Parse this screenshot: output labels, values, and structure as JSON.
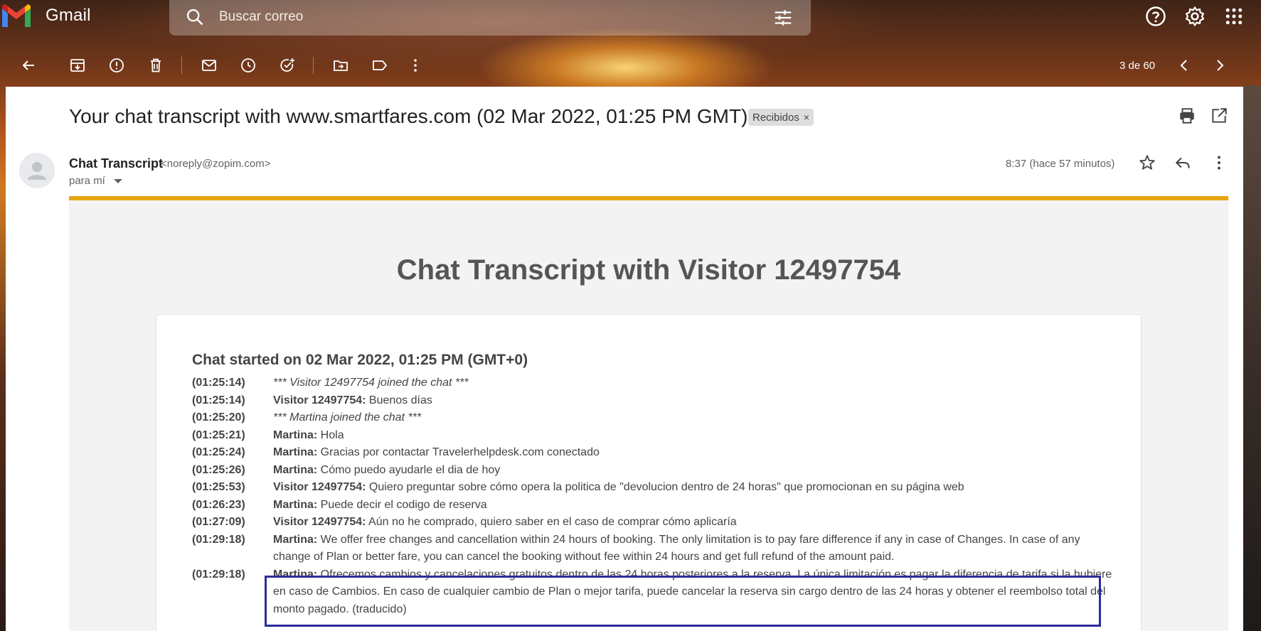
{
  "app": {
    "name": "Gmail"
  },
  "search": {
    "placeholder": "Buscar correo"
  },
  "top_icons": [
    "help-icon",
    "settings-icon",
    "apps-icon"
  ],
  "toolbar": {
    "icons": [
      "back-icon",
      "archive-icon",
      "report-spam-icon",
      "delete-icon",
      "mark-unread-icon",
      "snooze-icon",
      "add-task-icon",
      "move-to-icon",
      "label-icon",
      "more-icon"
    ],
    "pager": "3 de 60"
  },
  "email": {
    "subject": "Your chat transcript with www.smartfares.com (02 Mar 2022, 01:25 PM GMT)",
    "label": "Recibidos",
    "label_close": "×",
    "sender_name": "Chat Transcript",
    "sender_email": "<noreply@zopim.com>",
    "to": "para mí",
    "time": "8:37 (hace 57 minutos)"
  },
  "body": {
    "title": "Chat Transcript with Visitor 12497754",
    "started": "Chat started on 02 Mar 2022, 01:25 PM (GMT+0)",
    "lines": [
      {
        "time": "(01:25:14)",
        "who": "",
        "text": "*** Visitor 12497754 joined the chat ***",
        "system": true
      },
      {
        "time": "(01:25:14)",
        "who": "Visitor 12497754:",
        "text": " Buenos días",
        "system": false
      },
      {
        "time": "(01:25:20)",
        "who": "",
        "text": "*** Martina joined the chat ***",
        "system": true
      },
      {
        "time": "(01:25:21)",
        "who": "Martina:",
        "text": " Hola",
        "system": false
      },
      {
        "time": "(01:25:24)",
        "who": "Martina:",
        "text": " Gracias por contactar Travelerhelpdesk.com conectado",
        "system": false
      },
      {
        "time": "(01:25:26)",
        "who": "Martina:",
        "text": " Cómo puedo ayudarle el dia de hoy",
        "system": false
      },
      {
        "time": "(01:25:53)",
        "who": "Visitor 12497754:",
        "text": " Quiero preguntar sobre cómo opera la politica de \"devolucion dentro de 24 horas\" que promocionan en su página web",
        "system": false
      },
      {
        "time": "(01:26:23)",
        "who": "Martina:",
        "text": " Puede decir el codigo de reserva",
        "system": false
      },
      {
        "time": "(01:27:09)",
        "who": "Visitor 12497754:",
        "text": " Aún no he comprado, quiero saber en el caso de comprar cómo aplicaría",
        "system": false
      },
      {
        "time": "(01:29:18)",
        "who": "Martina:",
        "text": " We offer free changes and cancellation within 24 hours of booking. The only limitation is to pay fare difference if any in case of Changes. In case of any change of Plan or better fare, you can cancel the booking without fee within 24 hours and get full refund of the amount paid.",
        "system": false
      },
      {
        "time": "(01:29:18)",
        "who": "Martina:",
        "text": " Ofrecemos cambios y cancelaciones gratuitos dentro de las 24 horas posteriores a la reserva. La única limitación es pagar la diferencia de tarifa si la hubiere en caso de Cambios. En caso de cualquier cambio de Plan o mejor tarifa, puede cancelar la reserva sin cargo dentro de las 24 horas y obtener el reembolso total del monto pagado. (traducido)",
        "system": false
      }
    ]
  }
}
